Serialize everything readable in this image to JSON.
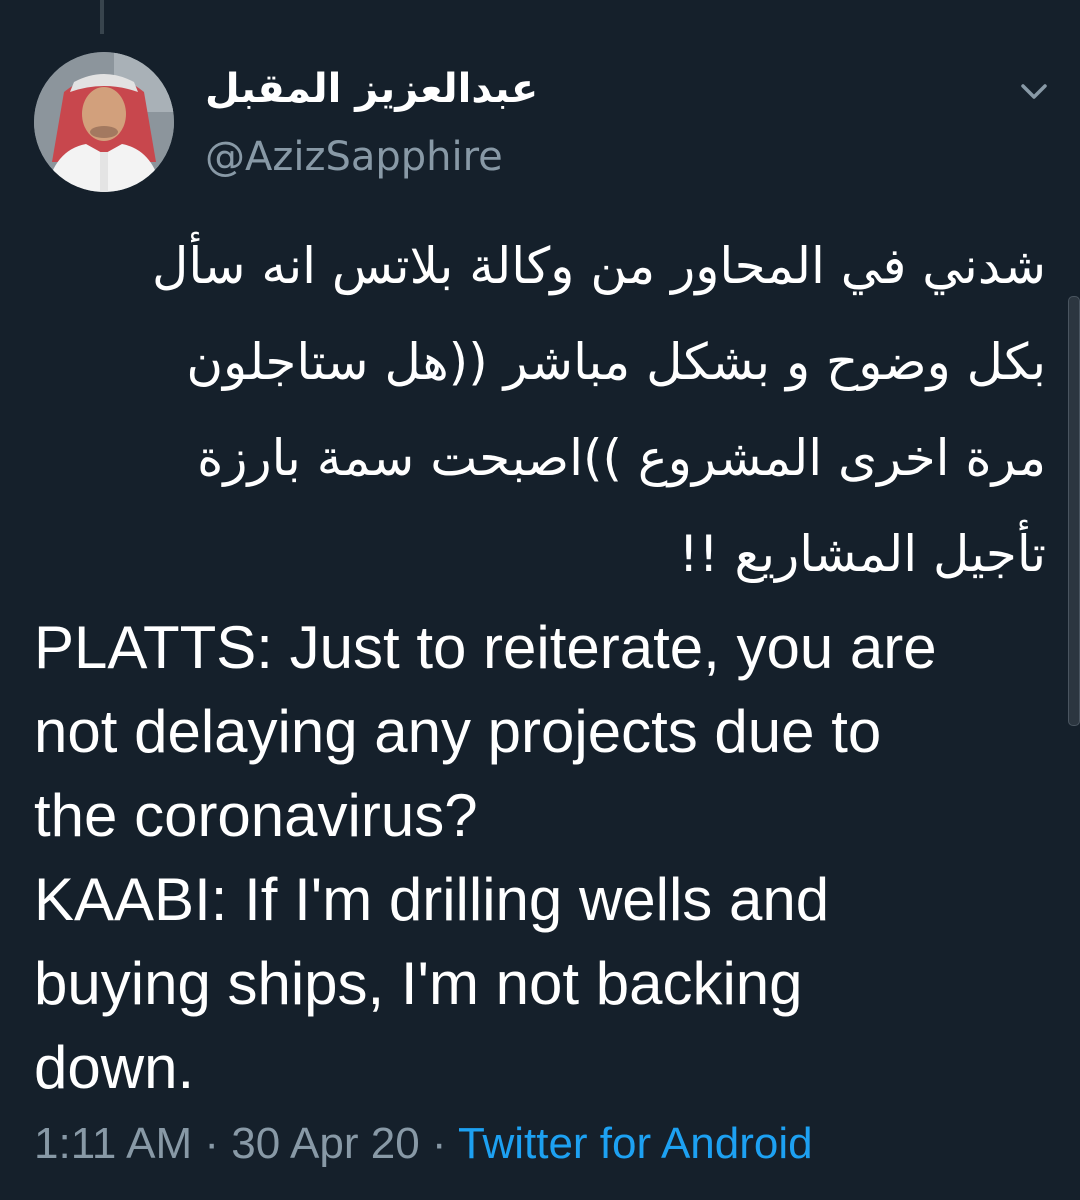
{
  "tweet": {
    "author": {
      "display_name": "عبدالعزيز المقبل",
      "handle": "@AzizSapphire",
      "avatar_icon": "user-avatar"
    },
    "menu_icon": "chevron-down-icon",
    "text_arabic_lines": [
      "شدني في المحاور من وكالة بلاتس انه سأل",
      "بكل وضوح و بشكل مباشر ((هل ستاجلون",
      "مرة اخرى المشروع ))اصبحت سمة بارزة",
      "تأجيل المشاريع !!"
    ],
    "text_english_lines": [
      "PLATTS: Just to reiterate, you are",
      "not delaying any projects due to",
      "the coronavirus?",
      "KAABI: If I'm drilling wells and",
      "buying ships, I'm not backing",
      "down."
    ],
    "time": "1:11 AM",
    "date": "30 Apr 20",
    "separator": "·",
    "source": "Twitter for Android"
  },
  "colors": {
    "background": "#15202b",
    "text": "#ffffff",
    "secondary": "#8899a6",
    "link": "#1da1f2"
  }
}
